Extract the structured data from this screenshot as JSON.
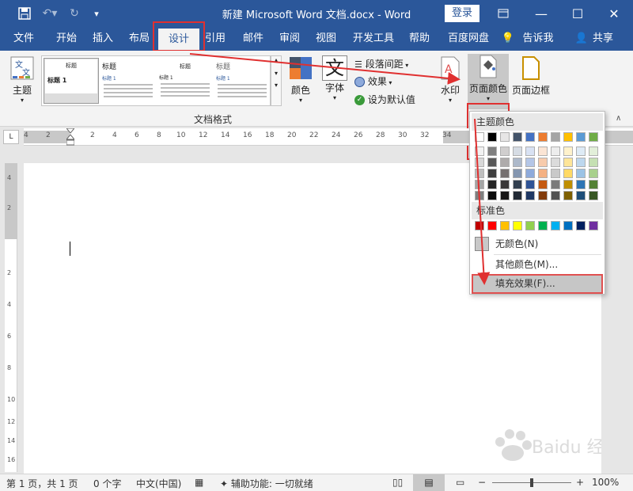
{
  "titlebar": {
    "title": "新建 Microsoft Word 文档.docx  -  Word",
    "login": "登录",
    "save_icon": "save-icon",
    "undo_icon": "undo-icon",
    "redo_icon": "redo-icon"
  },
  "tabs": [
    "文件",
    "开始",
    "插入",
    "布局",
    "设计",
    "引用",
    "邮件",
    "审阅",
    "视图",
    "开发工具",
    "帮助",
    "百度网盘",
    "告诉我",
    "共享"
  ],
  "active_tab": "设计",
  "ribbon": {
    "theme": "主题",
    "gallery_items": [
      {
        "title": "标题",
        "sub": "标题 1"
      },
      {
        "title": "标题",
        "sub": "标题 1"
      },
      {
        "title": "标题",
        "sub": "标题 1"
      },
      {
        "title": "标题",
        "sub": "标题 1"
      }
    ],
    "colors": "颜色",
    "fonts": "字体",
    "para_spacing": "段落间距",
    "effects": "效果",
    "set_default": "设为默认值",
    "watermark": "水印",
    "page_color": "页面颜色",
    "page_border": "页面边框",
    "group_label": "文档格式"
  },
  "ruler_h_numbers": [
    "4",
    "2",
    "",
    "2",
    "4",
    "6",
    "8",
    "10",
    "12",
    "14",
    "16",
    "18",
    "20",
    "22",
    "24",
    "26",
    "28",
    "30",
    "32",
    "34"
  ],
  "ruler_v_numbers": [
    "4",
    "2",
    "",
    "2",
    "4",
    "6",
    "8",
    "10",
    "12",
    "14",
    "16"
  ],
  "dropdown": {
    "theme_colors_header": "主题颜色",
    "standard_colors_header": "标准色",
    "no_color": "无颜色(N)",
    "more_colors": "其他颜色(M)...",
    "fill_effects": "填充效果(F)...",
    "theme_top_row": [
      "#ffffff",
      "#000000",
      "#e7e6e6",
      "#44546a",
      "#4472c4",
      "#ed7d31",
      "#a5a5a5",
      "#ffc000",
      "#5b9bd5",
      "#70ad47"
    ],
    "theme_shades": [
      [
        "#f2f2f2",
        "#7f7f7f",
        "#d0cece",
        "#d6dce4",
        "#d9e2f3",
        "#fbe5d5",
        "#ededed",
        "#fff2cc",
        "#deebf6",
        "#e2efd9"
      ],
      [
        "#d8d8d8",
        "#595959",
        "#aeabab",
        "#adb9ca",
        "#b4c6e7",
        "#f7cbac",
        "#dbdbdb",
        "#fee599",
        "#bdd7ee",
        "#c5e0b3"
      ],
      [
        "#bfbfbf",
        "#3f3f3f",
        "#757070",
        "#8496b0",
        "#8eaadb",
        "#f4b183",
        "#c9c9c9",
        "#ffd965",
        "#9cc3e5",
        "#a8d08d"
      ],
      [
        "#a5a5a5",
        "#262626",
        "#3a3838",
        "#323f4f",
        "#2f5496",
        "#c55a11",
        "#7b7b7b",
        "#bf8f00",
        "#2e75b5",
        "#538135"
      ],
      [
        "#7f7f7f",
        "#0c0c0c",
        "#171616",
        "#222a35",
        "#1f3864",
        "#833c0b",
        "#525252",
        "#7f6000",
        "#1e4e79",
        "#375623"
      ]
    ],
    "standard": [
      "#c00000",
      "#ff0000",
      "#ffc000",
      "#ffff00",
      "#92d050",
      "#00b050",
      "#00b0f0",
      "#0070c0",
      "#002060",
      "#7030a0"
    ]
  },
  "status": {
    "page": "第 1 页，共 1 页",
    "words": "0 个字",
    "lang": "中文(中国)",
    "accessibility": "辅助功能: 一切就绪",
    "zoom": "100%"
  },
  "watermark_text": "Baidu 经验"
}
